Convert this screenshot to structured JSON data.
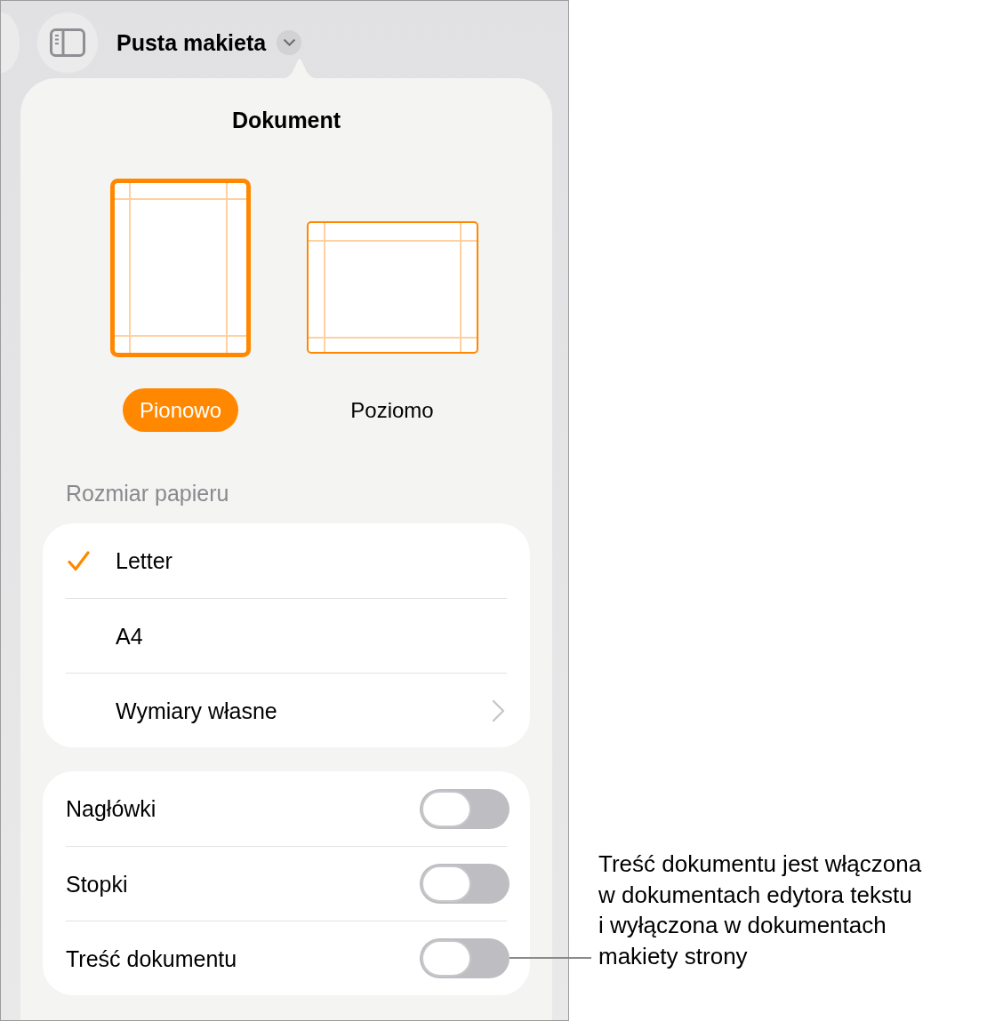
{
  "toolbar": {
    "title": "Pusta makieta"
  },
  "popover": {
    "title": "Dokument",
    "orientations": [
      {
        "kind": "portrait",
        "label": "Pionowo",
        "selected": true
      },
      {
        "kind": "landscape",
        "label": "Poziomo",
        "selected": false
      }
    ],
    "paper_size": {
      "heading": "Rozmiar papieru",
      "options": [
        {
          "kind": "option",
          "label": "Letter",
          "selected": true
        },
        {
          "kind": "option",
          "label": "A4",
          "selected": false
        },
        {
          "kind": "submenu",
          "label": "Wymiary własne",
          "selected": false
        }
      ]
    },
    "toggles": [
      {
        "label": "Nagłówki",
        "on": false
      },
      {
        "label": "Stopki",
        "on": false
      },
      {
        "label": "Treść dokumentu",
        "on": false
      }
    ]
  },
  "callout": {
    "lines": [
      "Treść dokumentu jest włączona",
      "w dokumentach edytora tekstu",
      "i wyłączona w dokumentach",
      "makiety strony"
    ]
  }
}
